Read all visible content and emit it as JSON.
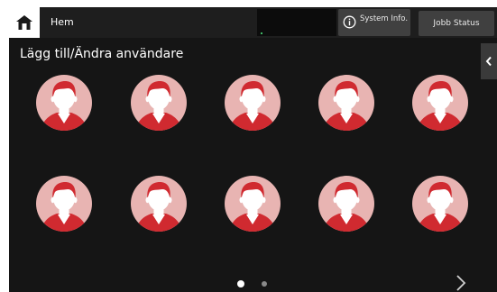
{
  "topbar": {
    "home_label": "Hem",
    "system_info_label": "System Info.",
    "job_status_label": "Jobb Status"
  },
  "page": {
    "title": "Lägg till/Ändra användare"
  },
  "user_tiles": {
    "rows": 2,
    "columns": 5,
    "count": 10,
    "icon": "user-silhouette-icon"
  },
  "pagination": {
    "total_pages": 2,
    "current_page": 1
  },
  "colors": {
    "background": "#151515",
    "avatar_circle": "#e8b4b2",
    "avatar_red": "#d02a30",
    "topbar": "#1e1e1e",
    "button": "#404040"
  }
}
